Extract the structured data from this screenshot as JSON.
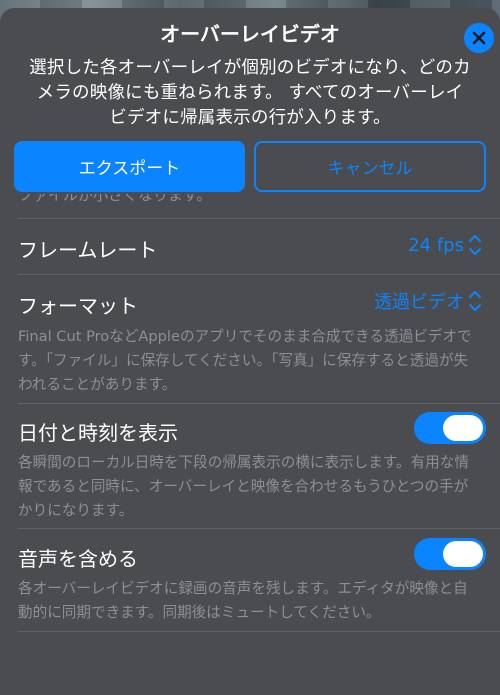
{
  "sheet": {
    "title": "オーバーレイビデオ",
    "description": "選択した各オーバーレイが個別のビデオになり、どのカメラの映像にも重ねられます。 すべてのオーバーレイビデオに帰属表示の行が入ります。",
    "export_label": "エクスポート",
    "cancel_label": "キャンセル",
    "partial_text": "ファイルが小さくなります。"
  },
  "settings": {
    "frame_rate": {
      "label": "フレームレート",
      "value": "24 fps"
    },
    "format": {
      "label": "フォーマット",
      "value": "透過ビデオ",
      "help": "Final Cut ProなどAppleのアプリでそのまま合成できる透過ビデオです。「ファイル」に保存してください。「写真」に保存すると透過が失われることがあります。"
    },
    "date_time": {
      "label": "日付と時刻を表示",
      "enabled": true,
      "help": "各瞬間のローカル日時を下段の帰属表示の横に表示します。有用な情報であると同時に、オーバーレイと映像を合わせるもうひとつの手がかりになります。"
    },
    "audio": {
      "label": "音声を含める",
      "enabled": true,
      "help": "各オーバーレイビデオに録画の音声を残します。エディタが映像と自動的に同期できます。同期後はミュートしてください。"
    }
  },
  "colors": {
    "accent": "#0a84ff",
    "sheet_bg": "#4b4c50",
    "secondary_text": "#8e8e93"
  }
}
